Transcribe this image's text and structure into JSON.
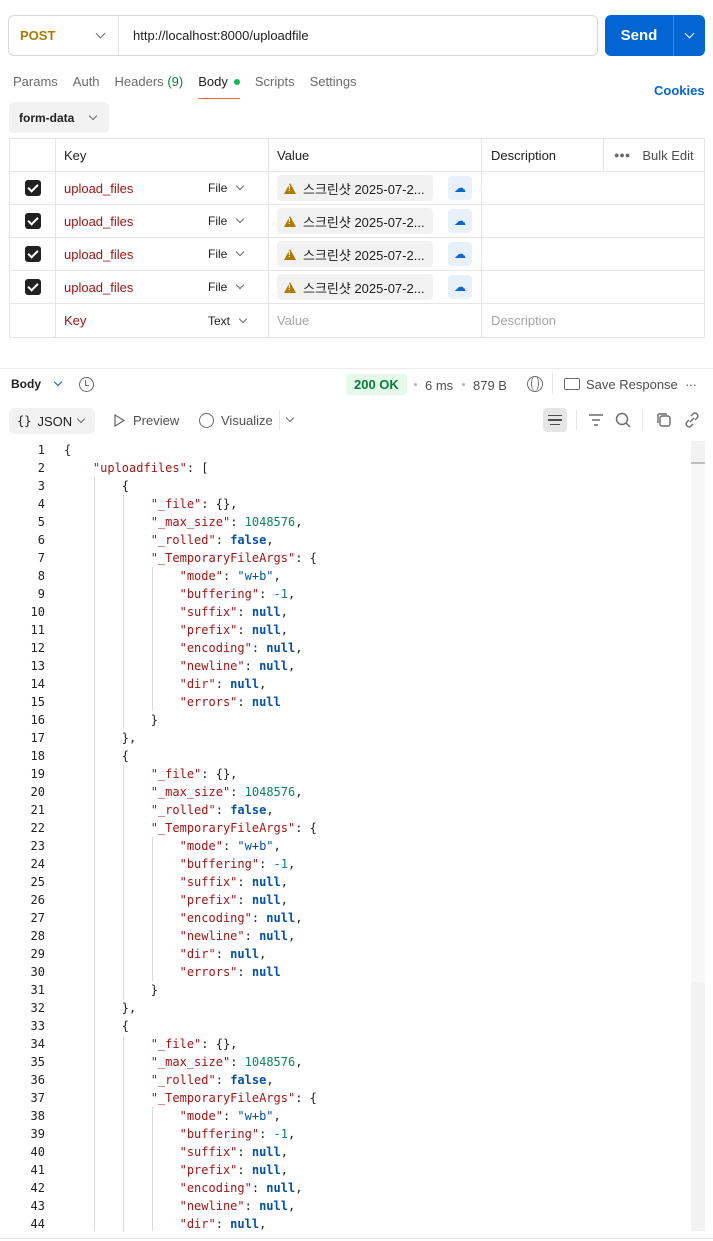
{
  "request": {
    "method": "POST",
    "url": "http://localhost:8000/uploadfile",
    "send_label": "Send"
  },
  "tabs": {
    "params": "Params",
    "auth": "Auth",
    "headers": "Headers",
    "headers_count": "(9)",
    "body": "Body",
    "scripts": "Scripts",
    "settings": "Settings",
    "cookies": "Cookies"
  },
  "body_mode": "form-data",
  "table": {
    "headers": {
      "key": "Key",
      "value": "Value",
      "description": "Description",
      "bulk_edit": "Bulk Edit"
    },
    "rows": [
      {
        "key": "upload_files",
        "type": "File",
        "value": "스크린샷 2025-07-2..."
      },
      {
        "key": "upload_files",
        "type": "File",
        "value": "스크린샷 2025-07-2..."
      },
      {
        "key": "upload_files",
        "type": "File",
        "value": "스크린샷 2025-07-2..."
      },
      {
        "key": "upload_files",
        "type": "File",
        "value": "스크린샷 2025-07-2..."
      }
    ],
    "placeholder": {
      "key": "Key",
      "type": "Text",
      "value": "Value",
      "description": "Description"
    }
  },
  "response": {
    "body_label": "Body",
    "status": "200 OK",
    "time": "6 ms",
    "size": "879 B",
    "save_label": "Save Response",
    "view_mode": "JSON",
    "preview": "Preview",
    "visualize": "Visualize"
  },
  "colors": {
    "send": "#0265d2",
    "method": "#ad7a03",
    "status_bg": "#e5f9ec",
    "status_text": "#0a7d3b",
    "json_key": "#a31515",
    "json_string": "#0451a5",
    "json_number": "#098658"
  }
}
